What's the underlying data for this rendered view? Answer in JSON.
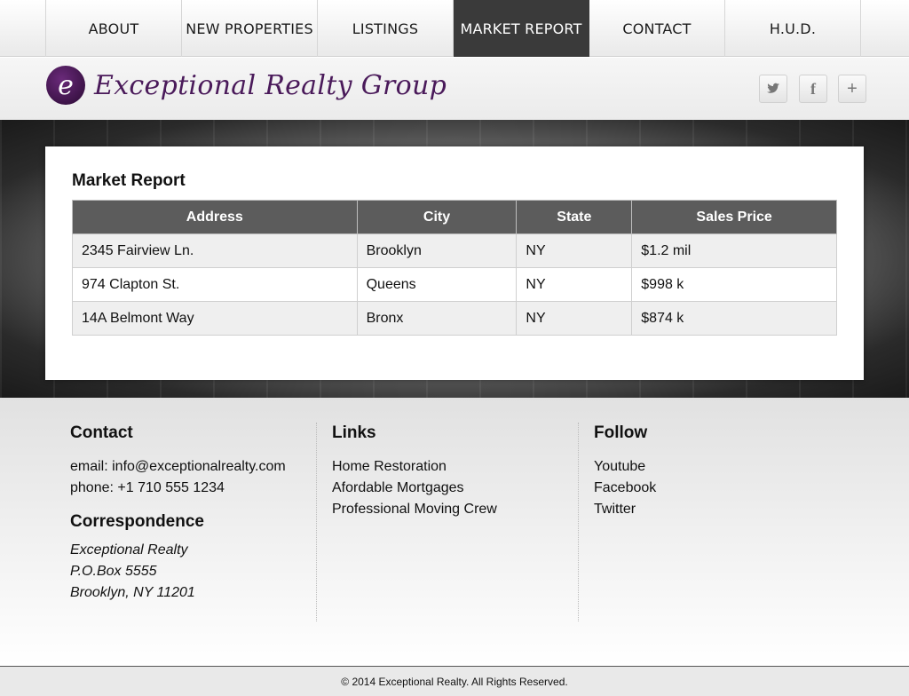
{
  "nav": {
    "items": [
      "ABOUT",
      "NEW PROPERTIES",
      "LISTINGS",
      "MARKET REPORT",
      "CONTACT",
      "H.U.D."
    ],
    "active": "MARKET REPORT"
  },
  "header": {
    "logo_letter": "e",
    "logo_text": "Exceptional Realty Group",
    "social": {
      "twitter_icon": "twitter-bird-icon",
      "facebook_glyph": "f",
      "plus_glyph": "+"
    }
  },
  "market": {
    "title": "Market Report",
    "columns": [
      "Address",
      "City",
      "State",
      "Sales Price"
    ],
    "rows": [
      [
        "2345 Fairview Ln.",
        "Brooklyn",
        "NY",
        "$1.2 mil"
      ],
      [
        "974 Clapton St.",
        "Queens",
        "NY",
        "$998 k"
      ],
      [
        "14A Belmont Way",
        "Bronx",
        "NY",
        "$874 k"
      ]
    ]
  },
  "footer": {
    "contact": {
      "heading": "Contact",
      "email": "email: info@exceptionalrealty.com",
      "phone": "phone: +1 710 555 1234"
    },
    "correspondence": {
      "heading": "Correspondence",
      "lines": [
        "Exceptional Realty",
        "P.O.Box 5555",
        "Brooklyn, NY 11201"
      ]
    },
    "links": {
      "heading": "Links",
      "items": [
        "Home Restoration",
        "Afordable Mortgages",
        "Professional Moving Crew"
      ]
    },
    "follow": {
      "heading": "Follow",
      "items": [
        "Youtube",
        "Facebook",
        "Twitter"
      ]
    },
    "copyright": "© 2014 Exceptional Realty. All Rights Reserved."
  },
  "colors": {
    "nav_active": "#3a3a3a",
    "table_header": "#5c5c5c",
    "brand_purple": "#4a1a5a"
  }
}
